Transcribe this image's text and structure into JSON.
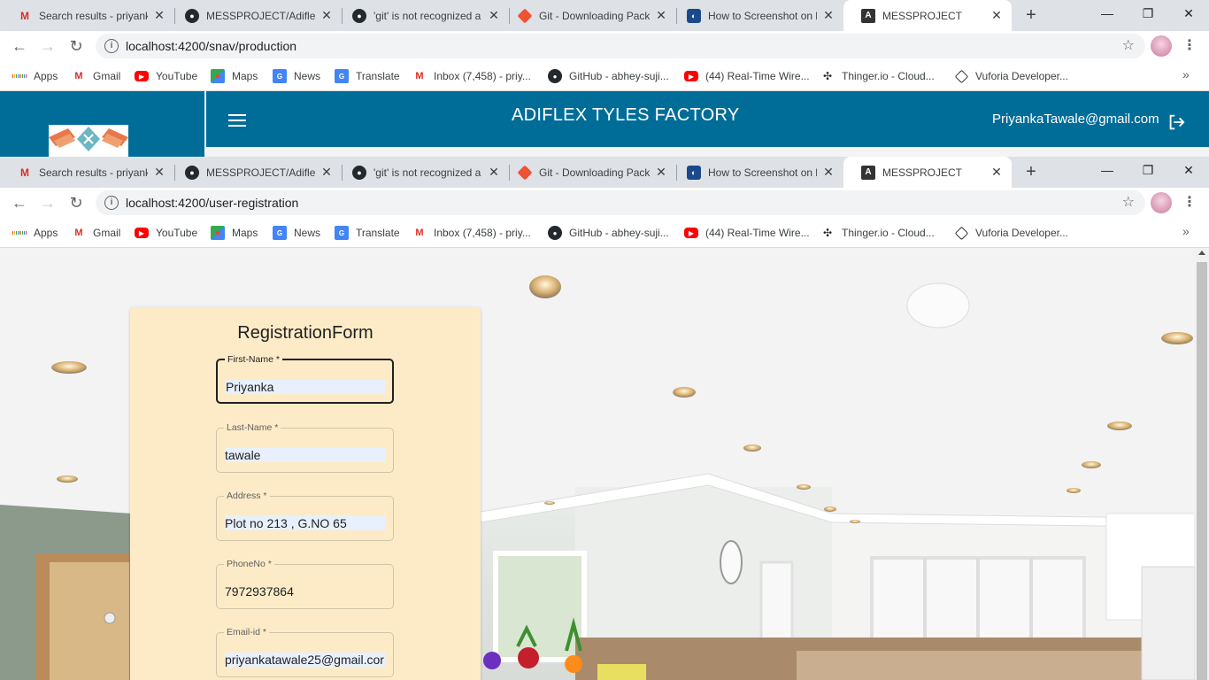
{
  "tabs": [
    {
      "title": "Search results - priyank",
      "icon": "gmail-icon",
      "active": false
    },
    {
      "title": "MESSPROJECT/Adiflex.r",
      "icon": "github-icon",
      "active": false
    },
    {
      "title": "'git' is not recognized a",
      "icon": "github-icon",
      "active": false
    },
    {
      "title": "Git - Downloading Pack",
      "icon": "git-icon",
      "active": false
    },
    {
      "title": "How to Screenshot on l",
      "icon": "site-icon",
      "active": false
    },
    {
      "title": "MESSPROJECT",
      "icon": "angular-icon",
      "active": true
    }
  ],
  "browser_one": {
    "url": "localhost:4200/snav/production"
  },
  "browser_two": {
    "url": "localhost:4200/user-registration"
  },
  "bookmarks": [
    {
      "label": "Apps",
      "icon": "apps-grid-icon"
    },
    {
      "label": "Gmail",
      "icon": "gmail-icon"
    },
    {
      "label": "YouTube",
      "icon": "youtube-icon"
    },
    {
      "label": "Maps",
      "icon": "maps-icon"
    },
    {
      "label": "News",
      "icon": "news-icon"
    },
    {
      "label": "Translate",
      "icon": "translate-icon"
    },
    {
      "label": "Inbox (7,458) - priy...",
      "icon": "gmail-icon"
    },
    {
      "label": "GitHub - abhey-suji...",
      "icon": "github-icon"
    },
    {
      "label": "(44) Real-Time Wire...",
      "icon": "youtube-icon"
    },
    {
      "label": "Thinger.io - Cloud...",
      "icon": "thinger-icon"
    },
    {
      "label": "Vuforia Developer...",
      "icon": "vuforia-icon"
    }
  ],
  "app": {
    "title": "ADIFLEX TYLES FACTORY",
    "user_email": "PriyankaTawale@gmail.com"
  },
  "form": {
    "heading": "RegistrationForm",
    "fields": [
      {
        "label": "First-Name *",
        "value": "Priyanka"
      },
      {
        "label": "Last-Name *",
        "value": "tawale"
      },
      {
        "label": "Address *",
        "value": "Plot no 213 , G.NO 65"
      },
      {
        "label": "PhoneNo *",
        "value": "7972937864"
      },
      {
        "label": "Email-id *",
        "value": "priyankatawale25@gmail.cor"
      }
    ]
  },
  "colors": {
    "app_bar": "#006d99",
    "card_bg": "#fdebc8",
    "chrome_bg": "#dee1e6",
    "autofill_bg": "#e8f0fe"
  }
}
